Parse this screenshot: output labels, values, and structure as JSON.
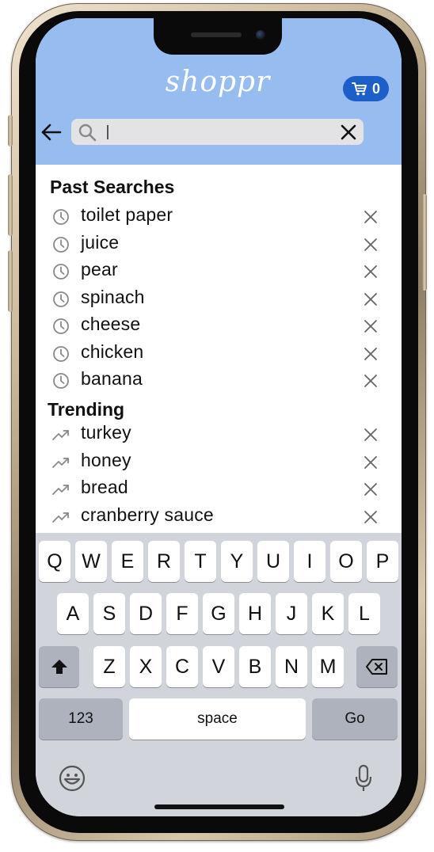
{
  "app": {
    "logo_text": "shoppr",
    "cart_count": "0",
    "accent_color": "#97bdf0",
    "cart_color": "#1c5fc8"
  },
  "search": {
    "value": "",
    "back_icon": "arrow-left-icon",
    "search_icon": "magnifier-icon",
    "clear_icon": "close-icon"
  },
  "past_searches": {
    "title": "Past Searches",
    "icon": "clock-icon",
    "items": [
      {
        "label": "toilet paper"
      },
      {
        "label": "juice"
      },
      {
        "label": "pear"
      },
      {
        "label": "spinach"
      },
      {
        "label": "cheese"
      },
      {
        "label": "chicken"
      },
      {
        "label": "banana"
      }
    ]
  },
  "trending": {
    "title": "Trending",
    "icon": "trending-up-icon",
    "items": [
      {
        "label": "turkey"
      },
      {
        "label": "honey"
      },
      {
        "label": "bread"
      },
      {
        "label": "cranberry sauce"
      }
    ]
  },
  "keyboard": {
    "row1": [
      "Q",
      "W",
      "E",
      "R",
      "T",
      "Y",
      "U",
      "I",
      "O",
      "P"
    ],
    "row2": [
      "A",
      "S",
      "D",
      "F",
      "G",
      "H",
      "J",
      "K",
      "L"
    ],
    "row3": [
      "Z",
      "X",
      "C",
      "V",
      "B",
      "N",
      "M"
    ],
    "numbers_label": "123",
    "space_label": "space",
    "go_label": "Go"
  }
}
